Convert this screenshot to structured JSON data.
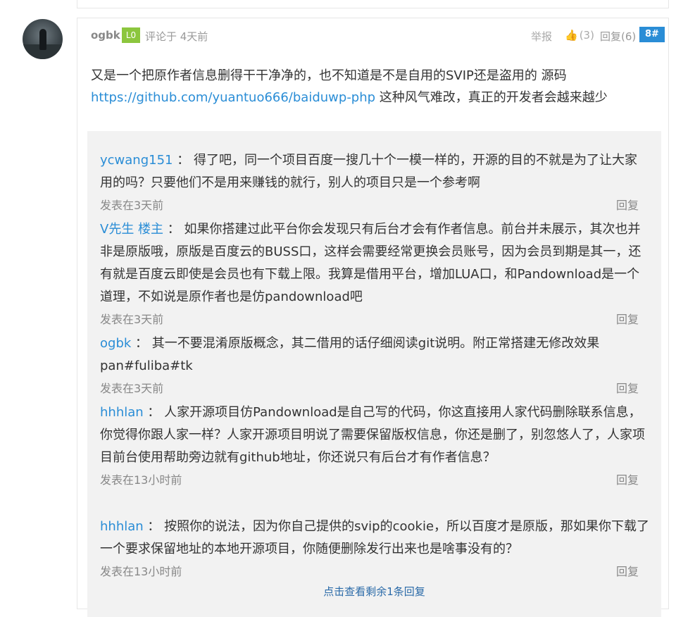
{
  "comment": {
    "author": "ogbk",
    "level": "L0",
    "meta": "评论于 4天前",
    "report": "举报",
    "like_label": "(3)",
    "reply_label": "回复(6)",
    "floor": "8#",
    "content_before_link": "又是一个把原作者信息删得干干净净的，也不知道是不是自用的SVIP还是盗用的 源码 ",
    "link": "https://github.com/yuantuo666/baiduwp-php",
    "content_after_link": " 这种风气难改，真正的开发者会越来越少"
  },
  "replies": [
    {
      "name": "ycwang151",
      "sep": "：",
      "text": "得了吧，同一个项目百度一搜几十个一模一样的，开源的目的不就是为了让大家用的吗？只要他们不是用来赚钱的就行，别人的项目只是一个参考啊",
      "time": "发表在3天前",
      "reply": "回复"
    },
    {
      "name": "V先生 楼主",
      "sep": "：",
      "text": "如果你搭建过此平台你会发现只有后台才会有作者信息。前台并未展示，其次也并非是原版哦，原版是百度云的BUSS口，这样会需要经常更换会员账号，因为会员到期是其一，还有就是百度云即使是会员也有下载上限。我算是借用平台，增加LUA口，和Pandownload是一个道理，不如说是原作者也是仿pandownload吧",
      "time": "发表在3天前",
      "reply": "回复"
    },
    {
      "name": "ogbk",
      "sep": "：",
      "text": "其一不要混淆原版概念，其二借用的话仔细阅读git说明。附正常搭建无修改效果pan#fuliba#tk",
      "time": "发表在3天前",
      "reply": "回复"
    },
    {
      "name": "hhhlan",
      "sep": "：",
      "text": "人家开源项目仿Pandownload是自己写的代码，你这直接用人家代码删除联系信息，你觉得你跟人家一样？人家开源项目明说了需要保留版权信息，你还是删了，别忽悠人了，人家项目前台使用帮助旁边就有github地址，你还说只有后台才有作者信息？",
      "time": "发表在13小时前",
      "reply": "回复"
    },
    {
      "name": "hhhlan",
      "sep": "：",
      "text": "按照你的说法，因为你自己提供的svip的cookie，所以百度才是原版，那如果你下载了一个要求保留地址的本地开源项目，你随便删除发行出来也是啥事没有的？",
      "time": "发表在13小时前",
      "reply": "回复"
    }
  ],
  "more_link": "点击查看剩余1条回复",
  "colors": {
    "link": "#2a8dd6",
    "level_badge": "#8cc63e",
    "floor_badge": "#2a8dd6",
    "reply_bg": "#f2f2f2"
  },
  "icons": {
    "like": "thumbs-up-icon"
  }
}
